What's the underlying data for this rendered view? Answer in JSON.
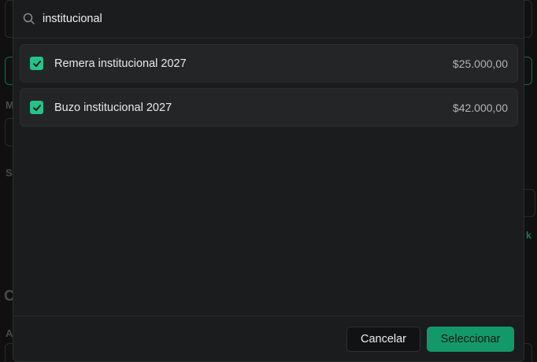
{
  "search": {
    "value": "institucional",
    "icon": "search-icon"
  },
  "items": [
    {
      "label": "Remera institucional 2027",
      "price": "$25.000,00",
      "checked": true
    },
    {
      "label": "Buzo institucional 2027",
      "price": "$42.000,00",
      "checked": true
    }
  ],
  "footer": {
    "cancel_label": "Cancelar",
    "select_label": "Seleccionar"
  },
  "background": {
    "fragments": [
      "M",
      "S",
      "k",
      "C",
      "A"
    ]
  },
  "colors": {
    "accent": "#13986a",
    "check": "#25c28a",
    "modal_bg": "#1b1c1d",
    "item_bg": "#242526"
  }
}
